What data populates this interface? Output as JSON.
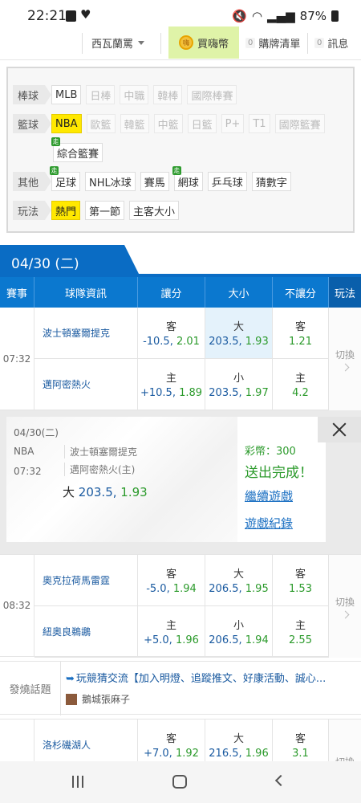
{
  "status": {
    "time": "22:21",
    "battery": "87%"
  },
  "nav": {
    "region": "西瓦蘭罵",
    "buy": "買嗨幣",
    "coin_glyph": "嗨",
    "cart_count": "0",
    "cart": "購牌清單",
    "msg_count": "0",
    "msg": "訊息"
  },
  "categories": {
    "baseball": {
      "label": "棒球",
      "items": [
        "MLB",
        "日棒",
        "中職",
        "韓棒",
        "國際棒賽"
      ]
    },
    "basketball": {
      "label": "籃球",
      "items": [
        "NBA",
        "歐籃",
        "韓籃",
        "中籃",
        "日籃",
        "P+",
        "T1",
        "國際籃賽",
        "綜合籃賽"
      ]
    },
    "other": {
      "label": "其他",
      "items": [
        "足球",
        "NHL冰球",
        "賽馬",
        "網球",
        "乒乓球",
        "猜數字"
      ]
    },
    "play": {
      "label": "玩法",
      "items": [
        "熱門",
        "第一節",
        "主客大小"
      ]
    },
    "live_tag": "走"
  },
  "date_tab": "04/30 (二)",
  "table_header": {
    "event": "賽事",
    "team": "球隊資訊",
    "spread": "讓分",
    "total": "大小",
    "moneyline": "不讓分",
    "play": "玩法"
  },
  "switch_label": "切換",
  "matches": [
    {
      "time": "07:32",
      "away": {
        "team": "波士頓塞爾提克",
        "spread_lbl": "客",
        "spread_line": "-10.5",
        "spread_odds": "2.01",
        "total_lbl": "大",
        "total_line": "203.5",
        "total_odds": "1.93",
        "ml_lbl": "客",
        "ml_odds": "1.21"
      },
      "home": {
        "team": "邁阿密熱火",
        "spread_lbl": "主",
        "spread_line": "+10.5",
        "spread_odds": "1.89",
        "total_lbl": "小",
        "total_line": "203.5",
        "total_odds": "1.97",
        "ml_lbl": "主",
        "ml_odds": "4.2"
      }
    },
    {
      "time": "08:32",
      "away": {
        "team": "奧克拉荷馬雷霆",
        "spread_lbl": "客",
        "spread_line": "-5.0",
        "spread_odds": "1.94",
        "total_lbl": "大",
        "total_line": "206.5",
        "total_odds": "1.95",
        "ml_lbl": "客",
        "ml_odds": "1.53"
      },
      "home": {
        "team": "紐奧良鵜鶘",
        "spread_lbl": "主",
        "spread_line": "+5.0",
        "spread_odds": "1.96",
        "total_lbl": "小",
        "total_line": "206.5",
        "total_odds": "1.94",
        "ml_lbl": "主",
        "ml_odds": "2.55"
      }
    },
    {
      "away": {
        "team": "洛杉磯湖人",
        "spread_lbl": "客",
        "spread_line": "+7.0",
        "spread_odds": "1.92",
        "total_lbl": "大",
        "total_line": "216.5",
        "total_odds": "1.96",
        "ml_lbl": "客",
        "ml_odds": "3.1"
      }
    }
  ],
  "popup": {
    "date": "04/30(二)",
    "league": "NBA",
    "time": "07:32",
    "team_away": "波士頓塞爾提克",
    "team_home": "邁阿密熱火(主)",
    "pick_label": "大",
    "pick_line": "203.5,",
    "pick_odds": "1.93",
    "coins": "彩幣：300",
    "status": "送出完成！",
    "continue": "繼續遊戲",
    "history": "遊戲紀錄"
  },
  "forum": {
    "label": "發燒話題",
    "title": "玩競猜交流【加入明燈、追蹤推文、好康活動、誠心...",
    "user": "鵝城張麻子"
  }
}
